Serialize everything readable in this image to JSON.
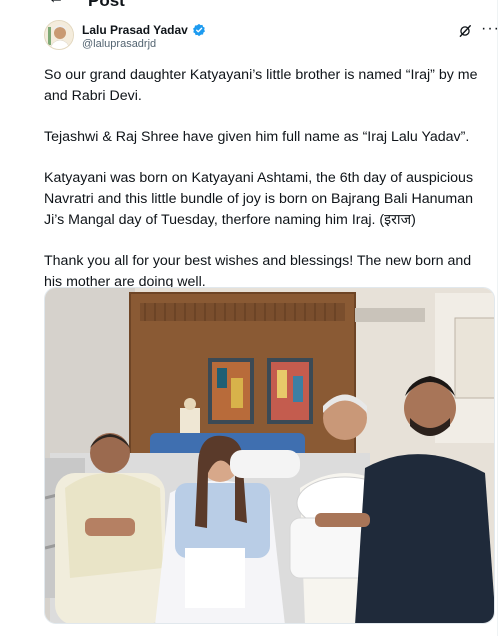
{
  "page": {
    "title": "Post"
  },
  "author": {
    "name": "Lalu Prasad Yadav",
    "handle": "@laluprasadrjd"
  },
  "tweet": {
    "paragraphs": [
      "So our grand daughter Katyayani’s little brother is named “Iraj” by me and Rabri Devi.",
      "Tejashwi & Raj Shree have given him full name as “Iraj Lalu Yadav”.",
      "Katyayani was born on Katyayani Ashtami, the 6th day of auspicious Navratri and this little bundle of joy is born on Bajrang Bali Hanuman Ji’s Mangal day of Tuesday, therfore naming him Iraj. (इराज)",
      "Thank you all for your best wishes and blessings! The new born and his mother are doing well."
    ]
  },
  "icons": {
    "back": "back-arrow-icon",
    "verified": "verified-badge-icon",
    "grok": "grok-icon",
    "more": "more-options-icon"
  },
  "colors": {
    "verified": "#1d9bf0",
    "text": "#0f1419",
    "secondary": "#536471"
  }
}
